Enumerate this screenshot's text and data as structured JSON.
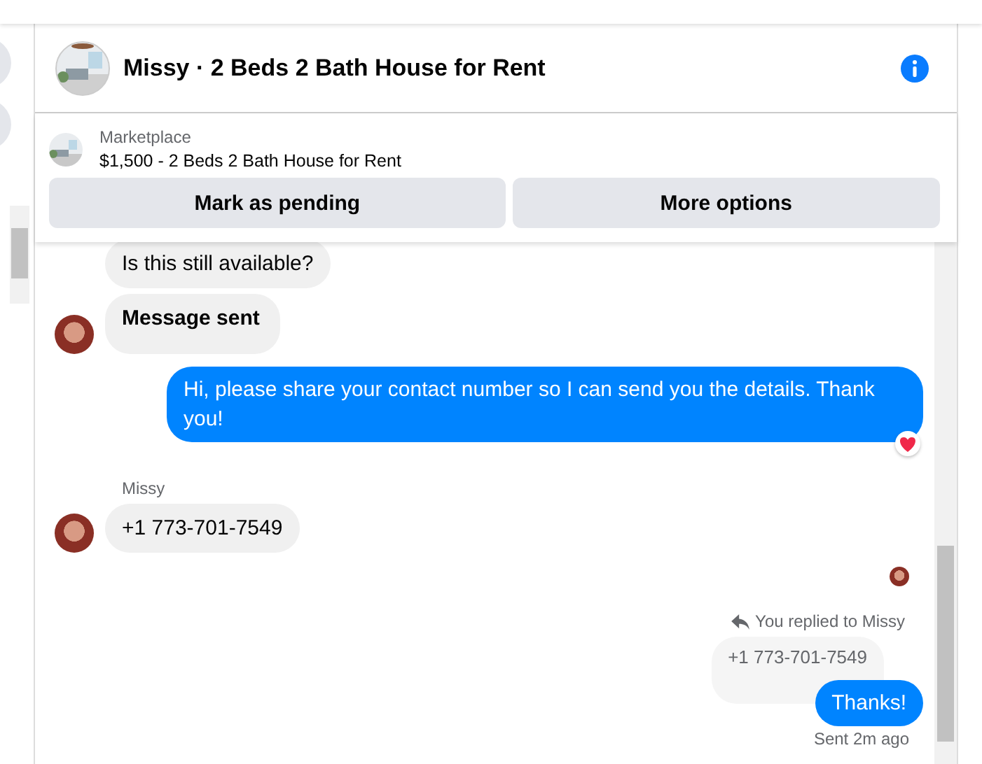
{
  "header": {
    "title": "Missy · 2 Beds 2 Bath House for Rent"
  },
  "listing": {
    "source": "Marketplace",
    "title": "$1,500 - 2 Beds 2 Bath House for Rent"
  },
  "actions": [
    "Mark as pending",
    "More options"
  ],
  "messages": [
    {
      "kind": "incoming",
      "text": "Is this still available?",
      "avatar": false,
      "bold": false
    },
    {
      "kind": "incoming",
      "text": "Message sent",
      "avatar": true,
      "bold": true
    },
    {
      "kind": "outgoing",
      "text": "Hi, please share your contact number so I can send you the details. Thank you!",
      "reacted": true
    },
    {
      "kind": "sender",
      "text": "Missy"
    },
    {
      "kind": "incoming",
      "text": "+1 773-701-7549",
      "avatar": true,
      "bold": false
    },
    {
      "kind": "seen"
    },
    {
      "kind": "reply_note",
      "text": "You replied to Missy"
    },
    {
      "kind": "quoted",
      "text": "+1 773-701-7549"
    },
    {
      "kind": "outgoing",
      "text": "Thanks!",
      "reacted": false
    },
    {
      "kind": "status",
      "text": "Sent 2m ago"
    }
  ]
}
